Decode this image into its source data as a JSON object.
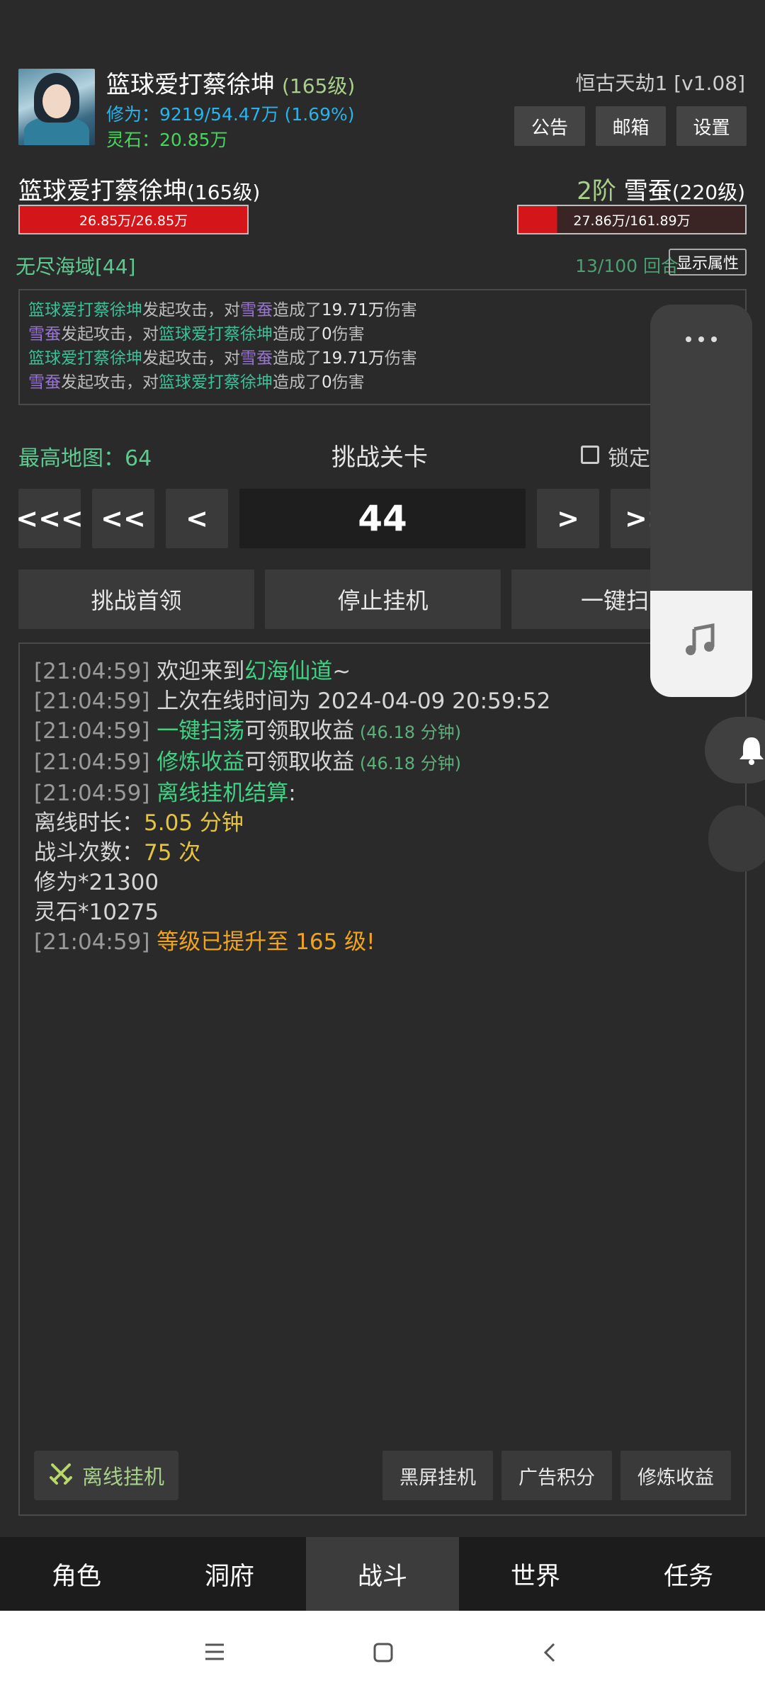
{
  "player": {
    "name": "篮球爱打蔡徐坤",
    "level": "(165级)",
    "xiuwei": "修为：9219/54.47万 (1.69%)",
    "lingshi": "灵石：20.85万",
    "server": "恒古天劫1 [v1.08]"
  },
  "top_buttons": {
    "notice": "公告",
    "mail": "邮箱",
    "settings": "设置"
  },
  "battle": {
    "self_name": "篮球爱打蔡徐坤",
    "self_level": "(165级)",
    "self_hp": "26.85万/26.85万",
    "self_hp_fraction": 1.0,
    "enemy_stage": "2阶",
    "enemy_name": "雪蚕",
    "enemy_level": "(220级)",
    "enemy_hp": "27.86万/161.89万",
    "enemy_hp_fraction": 0.172,
    "area": "无尽海域[44]",
    "rounds": "13/100 回合",
    "show_attr": "显示属性",
    "colors": {
      "hp": "#d4161b",
      "self_name": "#3dc098",
      "enemy_name": "#9a72d6"
    }
  },
  "battle_log": [
    {
      "a": "篮球爱打蔡徐坤",
      "b": "发起攻击，对",
      "c": "雪蚕",
      "d": "造成了",
      "e": "19.71万",
      "f": "伤害"
    },
    {
      "a": "雪蚕",
      "b": "发起攻击，对",
      "c": "篮球爱打蔡徐坤",
      "d": "造成了",
      "e": "0",
      "f": "伤害"
    },
    {
      "a": "篮球爱打蔡徐坤",
      "b": "发起攻击，对",
      "c": "雪蚕",
      "d": "造成了",
      "e": "19.71万",
      "f": "伤害"
    },
    {
      "a": "雪蚕",
      "b": "发起攻击，对",
      "c": "篮球爱打蔡徐坤",
      "d": "造成了",
      "e": "0",
      "f": "伤害"
    }
  ],
  "level_select": {
    "max_map": "最高地图：64",
    "title": "挑战关卡",
    "lock_label": "锁定",
    "nav": [
      "<<<",
      "<<",
      "<",
      ">",
      ">>"
    ],
    "current": "44"
  },
  "actions": {
    "boss": "挑战首领",
    "stop": "停止挂机",
    "sweep": "一键扫"
  },
  "syslog": {
    "l1": {
      "ts": "[21:04:59]",
      "text": " 欢迎来到",
      "hl": "幻海仙道",
      "tail": "~"
    },
    "l2": {
      "ts": "[21:04:59]",
      "text": " 上次在线时间为 2024-04-09 20:59:52"
    },
    "l3": {
      "ts": "[21:04:59]",
      "hl": " 一键扫荡",
      "text": "可领取收益",
      "sm": " (46.18 分钟)"
    },
    "l4": {
      "ts": "[21:04:59]",
      "hl": " 修炼收益",
      "text": "可领取收益",
      "sm": " (46.18 分钟)"
    },
    "l5": {
      "ts": "[21:04:59]",
      "hl": " 离线挂机结算",
      "text": ":"
    },
    "l6": {
      "label": "离线时长：",
      "value": "5.05 分钟"
    },
    "l7": {
      "label": "战斗次数：",
      "value": "75 次"
    },
    "l8": "修为*21300",
    "l9": "灵石*10275",
    "l10": {
      "ts": "[21:04:59]",
      "text": " 等级已提升至 165 级!"
    }
  },
  "bottom_buttons": {
    "offline": "离线挂机",
    "black_screen": "黑屏挂机",
    "ad_points": "广告积分",
    "cultivate": "修炼收益"
  },
  "tabs": [
    "角色",
    "洞府",
    "战斗",
    "世界",
    "任务"
  ],
  "active_tab": "战斗",
  "icons": {
    "more": "more-dots-icon",
    "music": "music-note-icon",
    "bell": "bell-icon",
    "sword": "crossed-swords-icon"
  }
}
